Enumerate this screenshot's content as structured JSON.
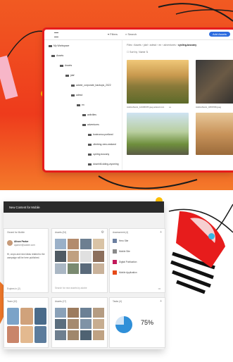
{
  "colors": {
    "accent": "#f15a22",
    "brand_red": "#e71c1c",
    "primary_button": "#2d6cdf",
    "yellow": "#ffc000",
    "blue": "#39b6e3"
  },
  "assets_window": {
    "menu_icon": "hamburger-icon",
    "filters_label": "Filters",
    "search_placeholder": "Search",
    "add_button": "Add Assets",
    "tree": {
      "workspace": "My Workspace",
      "items": [
        "Assets",
        "Assets",
        "jdaf",
        "adobe_corporate_backups_2022",
        "adesd",
        "en",
        "activities",
        "adventures",
        "bostrunna-portland",
        "climbing-new-zealand",
        "cycling-tuscany",
        "downhill-skiing-wyoming",
        "riverside-camping-australia"
      ]
    },
    "breadcrumb": {
      "path": "Files › Assets › jdaf › adesd › en › adventures ›",
      "current": "cycling-tuscany"
    },
    "sort": {
      "label": "Sort by",
      "value": "Name"
    },
    "thumbnails": [
      {
        "caption": "AdobeStock_12345678.jpeg",
        "meta": "adesd.com"
      },
      {
        "caption": "AdobeStock_3456789.jpeg",
        "meta": ""
      },
      {
        "caption": "",
        "meta": ""
      },
      {
        "caption": "",
        "meta": ""
      }
    ]
  },
  "dashboard_window": {
    "title": "New Content for Mobile",
    "person_card": {
      "header": "Owned for Mobile",
      "name": "Alison Parker",
      "email": "aparker@adobe.com",
      "note": "Hi, crops and new ideas related to the campaign will be here published.",
      "footer": "Expires in (2)"
    },
    "assets_card": {
      "header": "Assets (24)",
      "search_placeholder": "Search for new assets by adobe"
    },
    "assessments_card": {
      "header": "Assessment (4)",
      "items": [
        "Hero Site",
        "Mobile Site",
        "Digital Publication",
        "Mobile Application"
      ]
    },
    "team_card": {
      "header": "Team (12)"
    },
    "assets2_card": {
      "header": "Assets (17)"
    },
    "tasks_card": {
      "header": "Tasks (4)",
      "progress_percent": 75,
      "progress_label": "75%"
    }
  }
}
